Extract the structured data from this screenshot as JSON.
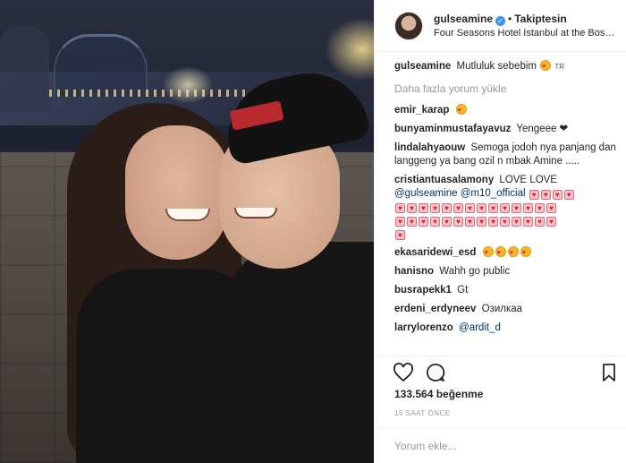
{
  "header": {
    "username": "gulseamine",
    "follow_label": "Takiptesin",
    "separator": "•",
    "location": "Four Seasons Hotel Istanbul at the Bosphorus"
  },
  "caption": {
    "username": "gulseamine",
    "text": "Mutluluk sebebim",
    "tag": "TR"
  },
  "load_more_label": "Daha fazla yorum yükle",
  "comments": [
    {
      "user": "emir_karap",
      "text": ""
    },
    {
      "user": "bunyaminmustafayavuz",
      "text": "Yengeee ❤"
    },
    {
      "user": "lindalahyaouw",
      "text": "Semoga jodoh nya panjang dan langgeng ya bang ozil n mbak Amine ....."
    },
    {
      "user": "cristiantuasalamony",
      "text": "LOVE LOVE",
      "mentions": [
        "@gulseamine",
        "@m10_official"
      ]
    },
    {
      "user": "ekasaridewi_esd",
      "text": ""
    },
    {
      "user": "hanisno",
      "text": "Wahh go public"
    },
    {
      "user": "busrapekk1",
      "text": "Gt"
    },
    {
      "user": "erdeni_erdyneev",
      "text": "Озилкаа"
    },
    {
      "user": "larrylorenzo",
      "text": "@ardit_d"
    }
  ],
  "likes_label": "133.564 beğenme",
  "time_label": "15 SAAT ÖNCE",
  "add_comment_placeholder": "Yorum ekle...",
  "icons": {
    "like": "heart-outline-icon",
    "comment": "speech-bubble-icon",
    "save": "bookmark-icon",
    "verified": "verified-badge-icon"
  },
  "colors": {
    "verified": "#3897f0",
    "mention": "#003569",
    "muted": "#999999",
    "text": "#262626"
  }
}
